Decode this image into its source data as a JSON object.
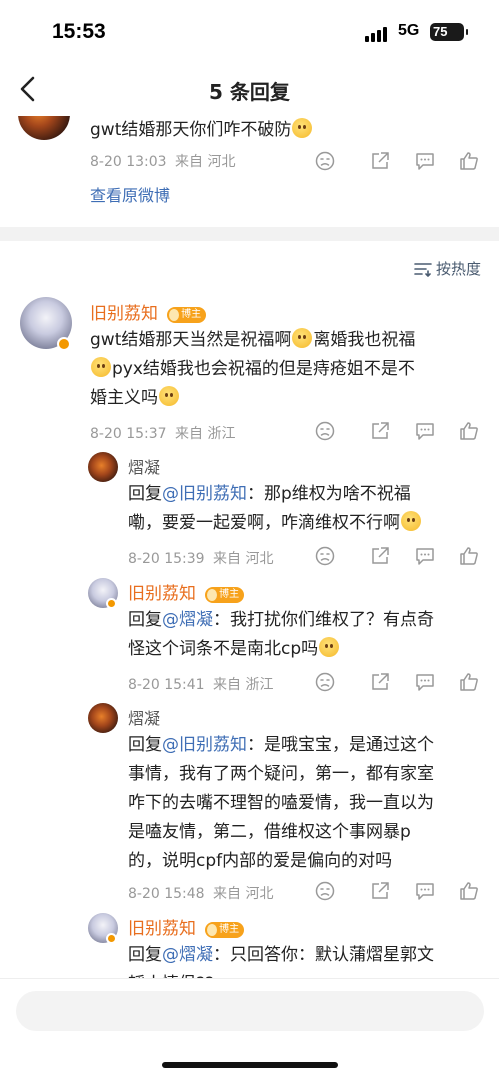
{
  "status": {
    "time": "15:53",
    "network": "5G",
    "battery": "75"
  },
  "nav": {
    "title": "5 条回复"
  },
  "top_comment": {
    "text": "gwt结婚那天你们咋不破防",
    "date": "8-20 13:03",
    "from": "来自 河北",
    "view_original": "查看原微博"
  },
  "sort": {
    "label": "按热度"
  },
  "main_comment": {
    "author": "旧别荔知",
    "badge": "博主",
    "line1a": "gwt结婚那天当然是祝福啊",
    "line1b": "离婚我也祝福",
    "line2": "pyx结婚我也会祝福的但是痔疮姐不是不",
    "line3": "婚主义吗",
    "date": "8-20 15:37",
    "from": "来自 浙江"
  },
  "replies": [
    {
      "author": "熠凝",
      "prefix": "回复",
      "mention": "@旧别荔知",
      "lines": [
        "：那p维权为啥不祝福",
        "嘞，要爱一起爱啊，咋滴维权不行啊"
      ],
      "date": "8-20 15:39",
      "from": "来自 河北"
    },
    {
      "author": "旧别荔知",
      "badge": "博主",
      "prefix": "回复",
      "mention": "@熠凝",
      "lines": [
        "：我打扰你们维权了？有点奇",
        "怪这个词条不是南北cp吗"
      ],
      "date": "8-20 15:41",
      "from": "来自 浙江"
    },
    {
      "author": "熠凝",
      "prefix": "回复",
      "mention": "@旧别荔知",
      "lines": [
        "：是哦宝宝，是通过这个",
        "事情，我有了两个疑问，第一，都有家室",
        "咋下的去嘴不理智的嗑爱情，我一直以为",
        "是嗑友情，第二，借维权这个事网暴p",
        "的，说明cpf内部的爱是偏向的对吗"
      ],
      "date": "8-20 15:48",
      "from": "来自 河北"
    },
    {
      "author": "旧别荔知",
      "badge": "博主",
      "prefix": "回复",
      "mention": "@熠凝",
      "lines": [
        "：只回答你：默认蒲熠星郭文",
        "韬小情侣??"
      ]
    }
  ]
}
